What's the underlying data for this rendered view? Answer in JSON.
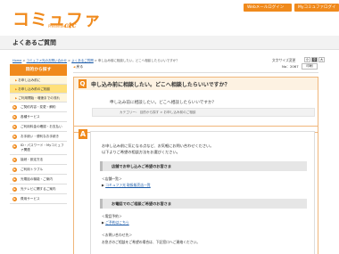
{
  "header": {
    "logo_text": "コミュファ",
    "logo_sub": "Presented by",
    "logo_brand": "ctc",
    "webmail_login": "Webメールログイン",
    "mycommufa_login": "Myコミュファログイン"
  },
  "page_title": "よくあるご質問",
  "breadcrumb": {
    "items": [
      "Home",
      "コミュファ光のお問い合わせ",
      "よくあるご質問",
      "申し込み前に相談したい。どこへ相談したらいいですか？"
    ],
    "sep": ">"
  },
  "font_size": {
    "label": "文字サイズ変更",
    "small": "小",
    "medium": "中",
    "large": "大"
  },
  "sidebar": {
    "header": "目的から探す",
    "items": [
      {
        "label": "お申し込み前に",
        "sub": false
      },
      {
        "label": "お申し込み前のご相談",
        "sub": true,
        "active": true
      },
      {
        "label": "ご利用開始・増速までの流れ",
        "sub": true,
        "active": false
      },
      {
        "label": "ご契約内容・変更・解約",
        "sub": false
      },
      {
        "label": "各種サービス",
        "sub": false
      },
      {
        "label": "ご利用料金の確認・お支払い",
        "sub": false
      },
      {
        "label": "お手続い・便利なお手続き",
        "sub": false
      },
      {
        "label": "ID・パスワード・Myコミュファ関連",
        "sub": false
      },
      {
        "label": "接続・設定方法",
        "sub": false
      },
      {
        "label": "ご利用トラブル",
        "sub": false
      },
      {
        "label": "光電話の機能・ご案内",
        "sub": false
      },
      {
        "label": "光テレビに関するご案内",
        "sub": false
      },
      {
        "label": "費用サービス",
        "sub": false
      }
    ]
  },
  "faq": {
    "back_label": "戻る",
    "number": "No：2067",
    "print_label": "印刷",
    "question_badge": "Q",
    "question_title": "申し込み前に相談したい。どこへ相談したらいいですか？",
    "question_body": "申し込み前に相談したい。どこへ相談したらいいですか？",
    "category": "カテゴリー： 目的から探す > お申し込み前のご相談",
    "answer_badge": "A",
    "answer_lines": [
      "お申し込み前に気になる点など、お気軽にお問い合わせください。",
      "以下よりご希望の相談方法をお選びください。"
    ],
    "section1_title": "店舗でお申し込みご希望のお客さま",
    "section1_label": "＜店舗一覧＞",
    "section1_link": "コミュファ光 取扱販売店一覧",
    "section2_title": "お電話でのご相談ご希望のお客さま",
    "section2_label": "＜電話予約＞",
    "section2_link": "ご予約はこちら",
    "section3_label": "＜お問い合わせ先＞",
    "section3_text": "お急ぎのご相談をご希望の場合は、下記窓口へご連絡ください。"
  }
}
